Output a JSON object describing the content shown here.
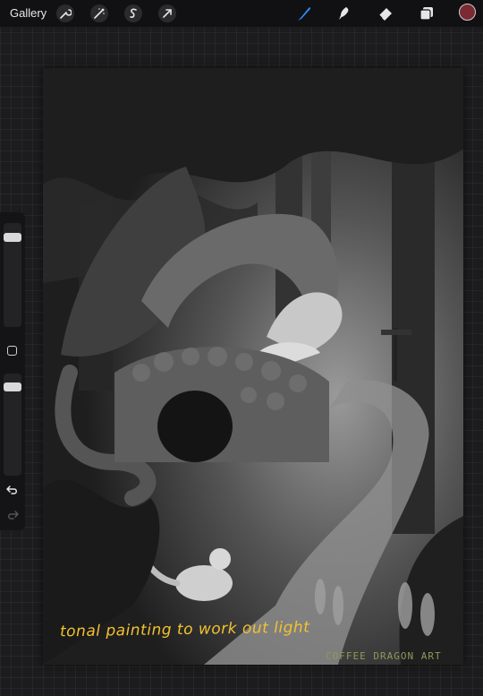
{
  "toolbar": {
    "gallery_label": "Gallery",
    "left_tools": [
      {
        "name": "actions-wrench-icon"
      },
      {
        "name": "adjustments-wand-icon"
      },
      {
        "name": "selection-s-icon"
      },
      {
        "name": "transform-arrow-icon"
      }
    ],
    "right_tools": [
      {
        "name": "brush-icon",
        "active": true,
        "color": "#2f8cff"
      },
      {
        "name": "smudge-icon"
      },
      {
        "name": "eraser-icon"
      },
      {
        "name": "layers-icon"
      }
    ],
    "current_color": "#7a2a30"
  },
  "sidebar": {
    "brush_size_level": 0.1,
    "opacity_level": 0.1,
    "icons": [
      "modify-square-icon",
      "undo-icon",
      "redo-icon"
    ]
  },
  "canvas": {
    "artwork": "grayscale forest dragon illustration",
    "caption": "tonal painting to work out light",
    "signature": "COFFEE DRAGON ART"
  },
  "colors": {
    "accent": "#2f8cff",
    "caption": "#f2c230",
    "signature": "#8a9a5b"
  }
}
